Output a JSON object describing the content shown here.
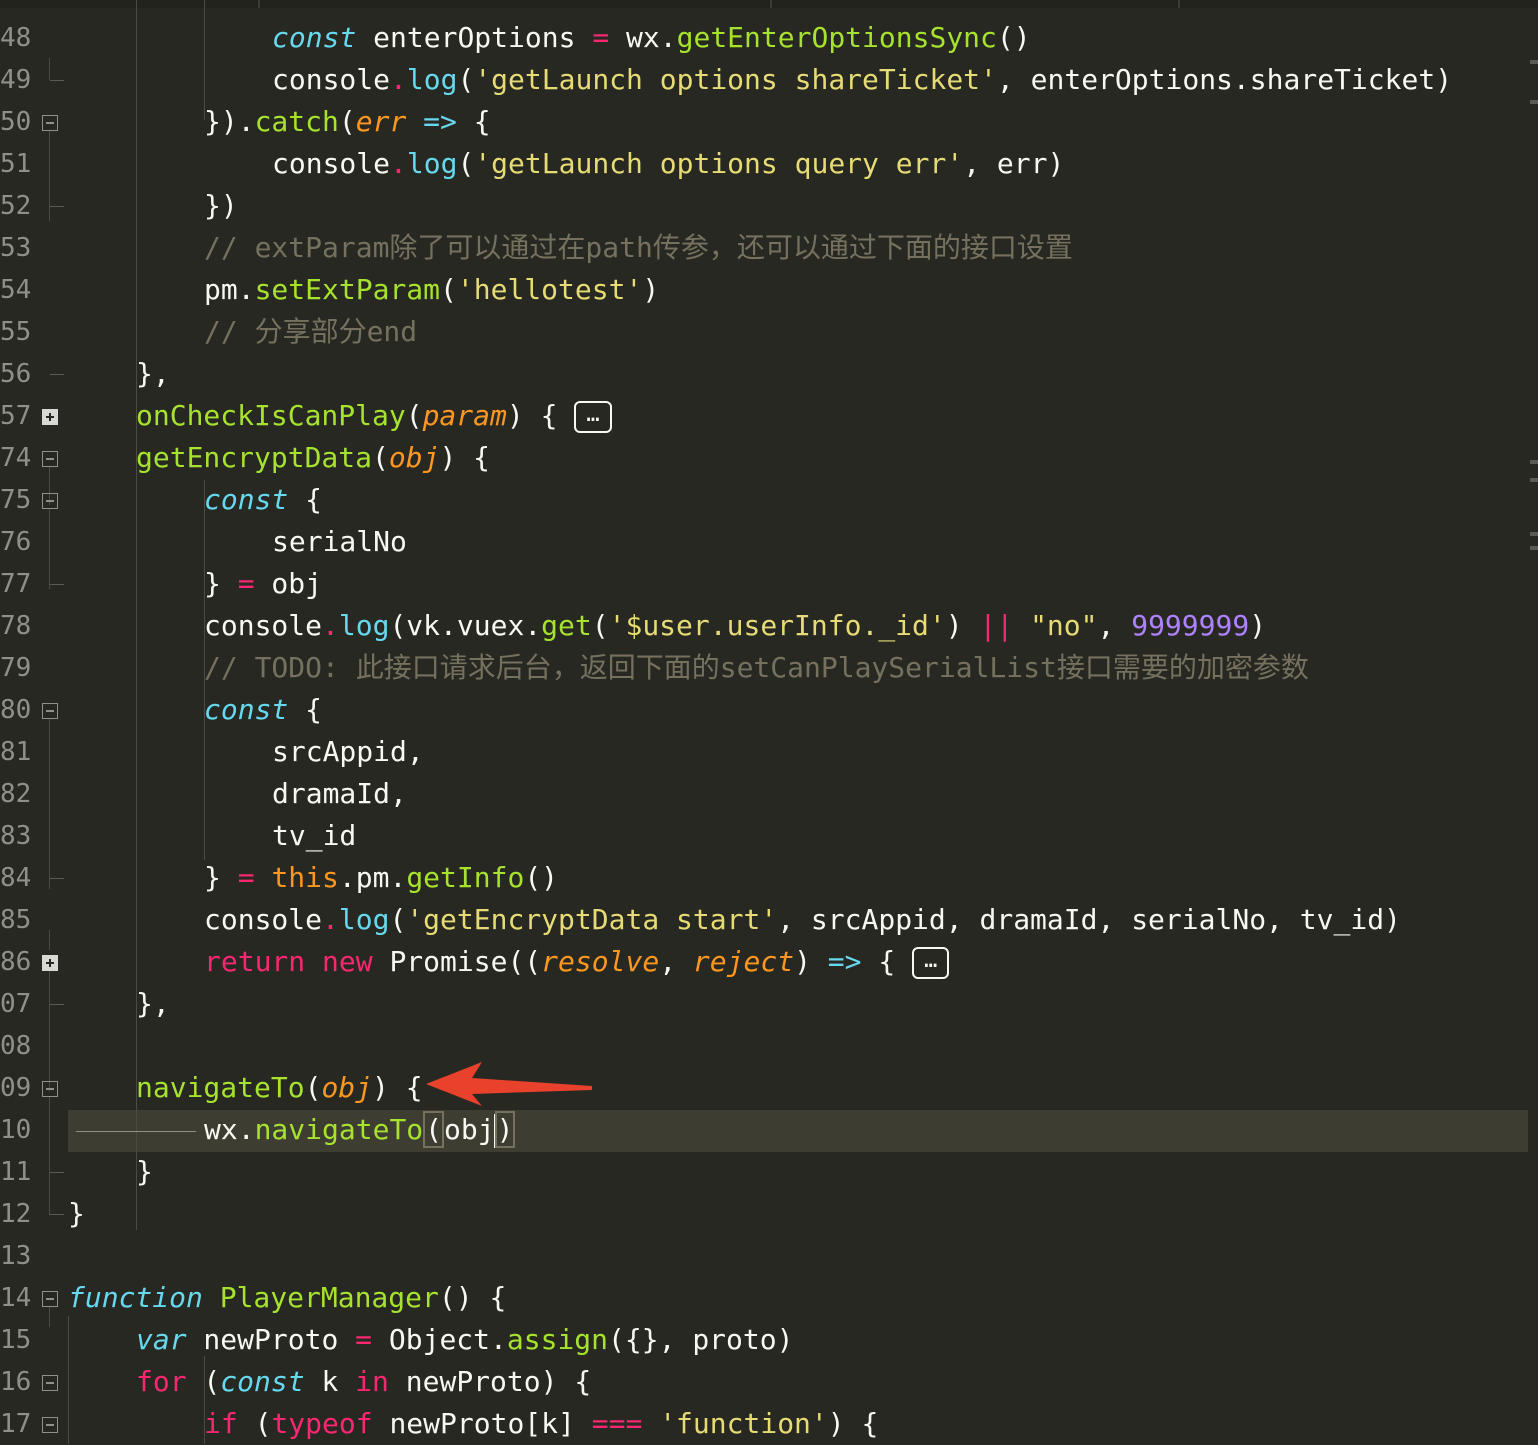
{
  "gutter": {
    "line_numbers": [
      "48",
      "49",
      "50",
      "51",
      "52",
      "53",
      "54",
      "55",
      "56",
      "57",
      "74",
      "75",
      "76",
      "77",
      "78",
      "79",
      "80",
      "81",
      "82",
      "83",
      "84",
      "85",
      "86",
      "07",
      "08",
      "09",
      "10",
      "11",
      "12",
      "13",
      "14",
      "15",
      "16",
      "17"
    ]
  },
  "code": {
    "l48": {
      "kw": "const",
      "a": " enterOptions ",
      "op": "=",
      "b": " wx.",
      "fn": "getEnterOptionsSync",
      "c": "()"
    },
    "l49": {
      "a": "console",
      "dot": ".",
      "fn": "log",
      "b": "(",
      "str": "'getLaunch options shareTicket'",
      "c": ", enterOptions.shareTicket)"
    },
    "l50": {
      "a": "}).",
      "fn": "catch",
      "b": "(",
      "pa": "err",
      "arrow": " =>",
      "c": " {"
    },
    "l51": {
      "a": "console",
      "dot": ".",
      "fn": "log",
      "b": "(",
      "str": "'getLaunch options query err'",
      "c": ", err)"
    },
    "l52": {
      "a": "})"
    },
    "l53": {
      "cm": "// extParam除了可以通过在path传参，还可以通过下面的接口设置"
    },
    "l54": {
      "a": "pm.",
      "fn": "setExtParam",
      "b": "(",
      "str": "'hellotest'",
      "c": ")"
    },
    "l55": {
      "cm": "// 分享部分end"
    },
    "l56": {
      "a": "},"
    },
    "l57": {
      "fn": "onCheckIsCanPlay",
      "a": "(",
      "pa": "param",
      "b": ") { ",
      "fold": "…"
    },
    "l74": {
      "fn": "getEncryptData",
      "a": "(",
      "pa": "obj",
      "b": ") {"
    },
    "l75": {
      "st": "const",
      "a": " {"
    },
    "l76": {
      "a": "serialNo"
    },
    "l77": {
      "a": "} ",
      "op": "=",
      "b": " obj"
    },
    "l78": {
      "a": "console",
      "dot": ".",
      "fn": "log",
      "b": "(vk.vuex.",
      "fn2": "get",
      "c": "(",
      "str": "'$user.userInfo._id'",
      "d": ") ",
      "op": "||",
      "e": " ",
      "str2": "\"no\"",
      "f": ", ",
      "num": "9999999",
      "g": ")"
    },
    "l79": {
      "cm": "// TODO: 此接口请求后台，返回下面的setCanPlaySerialList接口需要的加密参数"
    },
    "l80": {
      "st": "const",
      "a": " {"
    },
    "l81": {
      "a": "srcAppid,"
    },
    "l82": {
      "a": "dramaId,"
    },
    "l83": {
      "a": "tv_id"
    },
    "l84": {
      "a": "} ",
      "op": "=",
      "b": " ",
      "this": "this",
      "c": ".pm.",
      "fn": "getInfo",
      "d": "()"
    },
    "l85": {
      "a": "console",
      "dot": ".",
      "fn": "log",
      "b": "(",
      "str": "'getEncryptData start'",
      "c": ", srcAppid, dramaId, serialNo, tv_id)"
    },
    "l86": {
      "kw": "return",
      "sp": " ",
      "kw2": "new",
      "a": " Promise((",
      "pa": "resolve",
      "b": ", ",
      "pa2": "reject",
      "c": ") ",
      "arrow": "=>",
      "d": " { ",
      "fold": "…"
    },
    "l07": {
      "a": "},"
    },
    "l09": {
      "fn": "navigateTo",
      "a": "(",
      "pa": "obj",
      "b": ") {"
    },
    "l10": {
      "a": "wx.",
      "fn": "navigateTo",
      "b": "(",
      "c": "obj",
      ")": ")"
    },
    "l11": {
      "a": "}"
    },
    "l12": {
      "a": "}"
    },
    "l14": {
      "st": "function",
      "a": " ",
      "fn": "PlayerManager",
      "b": "() {"
    },
    "l15": {
      "st": "var",
      "a": " newProto ",
      "op": "=",
      "b": " Object.",
      "fn": "assign",
      "c": "({}, proto)"
    },
    "l16": {
      "kw": "for",
      "a": " (",
      "st": "const",
      "b": " k ",
      "kw2": "in",
      "c": " newProto) {"
    },
    "l17": {
      "kw": "if",
      "a": " (",
      "kw2": "typeof",
      "b": " newProto[k] ",
      "op": "===",
      "c": " ",
      "str": "'function'",
      "d": ") {"
    }
  },
  "colors": {
    "background": "#272822",
    "keyword": "#f92672",
    "storage": "#66d9ef",
    "function": "#a6e22e",
    "string": "#e6db74",
    "parameter": "#fd971f",
    "comment": "#75715e",
    "number": "#ae81ff",
    "annotation_arrow": "#e8412c"
  }
}
